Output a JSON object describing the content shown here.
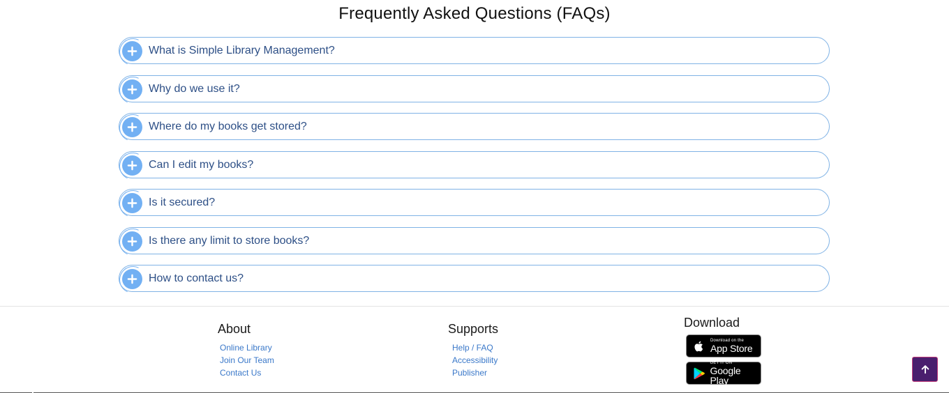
{
  "faq": {
    "title": "Frequently Asked Questions (FAQs)",
    "items": [
      {
        "question": "What is Simple Library Management?"
      },
      {
        "question": "Why do we use it?"
      },
      {
        "question": "Where do my books get stored?"
      },
      {
        "question": "Can I edit my books?"
      },
      {
        "question": "Is it secured?"
      },
      {
        "question": "Is there any limit to store books?"
      },
      {
        "question": "How to contact us?"
      }
    ],
    "toggle_icon": "plus-icon"
  },
  "footer": {
    "about": {
      "title": "About",
      "links": [
        "Online Library",
        "Join Our Team",
        "Contact Us"
      ]
    },
    "supports": {
      "title": "Supports",
      "links": [
        "Help / FAQ",
        "Accessibility",
        "Publisher"
      ]
    },
    "download": {
      "title": "Download",
      "app_store": {
        "small": "Download on the",
        "big": "App Store"
      },
      "google_play": {
        "small": "GET IT ON",
        "big": "Google Play"
      }
    }
  },
  "back_to_top": {
    "icon": "arrow-up-icon"
  },
  "colors": {
    "accent": "#72b0f3",
    "question_text": "#2d4f86",
    "link": "#3a78c9",
    "back_to_top_bg": "#4a1f6e"
  }
}
